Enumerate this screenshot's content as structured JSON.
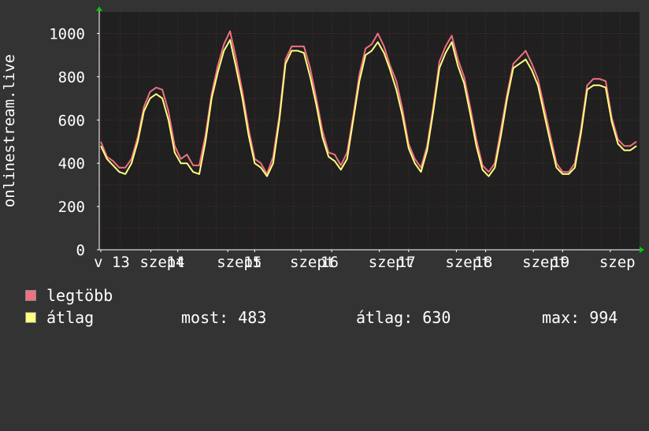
{
  "chart_data": {
    "type": "line",
    "ylabel": "onlinestream.live",
    "ylim": [
      0,
      1100
    ],
    "yticks": [
      0,
      200,
      400,
      600,
      800,
      1000
    ],
    "xlim": [
      12.98,
      20.0
    ],
    "xticks": [
      {
        "value": 13,
        "label": "v 13"
      },
      {
        "value": 13.65,
        "label": "szept"
      },
      {
        "value": 14,
        "label": "14"
      },
      {
        "value": 14.65,
        "label": "szept"
      },
      {
        "value": 15,
        "label": "15"
      },
      {
        "value": 15.6,
        "label": "szept"
      },
      {
        "value": 16,
        "label": "16"
      },
      {
        "value": 16.62,
        "label": "szept"
      },
      {
        "value": 17,
        "label": "17"
      },
      {
        "value": 17.62,
        "label": "szept"
      },
      {
        "value": 18,
        "label": "18"
      },
      {
        "value": 18.62,
        "label": "szept"
      },
      {
        "value": 19,
        "label": "19"
      },
      {
        "value": 19.62,
        "label": "szep"
      }
    ],
    "grid": true,
    "series": [
      {
        "name": "legtöbb",
        "color": "#f07080",
        "x": [
          13.0,
          13.08,
          13.16,
          13.24,
          13.32,
          13.4,
          13.48,
          13.56,
          13.64,
          13.72,
          13.8,
          13.88,
          13.96,
          14.04,
          14.12,
          14.2,
          14.28,
          14.36,
          14.44,
          14.52,
          14.6,
          14.68,
          14.76,
          14.84,
          14.92,
          15.0,
          15.08,
          15.16,
          15.24,
          15.32,
          15.4,
          15.48,
          15.56,
          15.64,
          15.72,
          15.8,
          15.88,
          15.96,
          16.04,
          16.12,
          16.2,
          16.28,
          16.36,
          16.44,
          16.52,
          16.6,
          16.68,
          16.76,
          16.84,
          16.92,
          17.0,
          17.08,
          17.16,
          17.24,
          17.32,
          17.4,
          17.48,
          17.56,
          17.64,
          17.72,
          17.8,
          17.88,
          17.96,
          18.04,
          18.12,
          18.2,
          18.28,
          18.36,
          18.44,
          18.52,
          18.6,
          18.68,
          18.76,
          18.84,
          18.92,
          19.0,
          19.08,
          19.16,
          19.24,
          19.32,
          19.4,
          19.48,
          19.56,
          19.64,
          19.72,
          19.8,
          19.88,
          19.96
        ],
        "values": [
          500,
          430,
          410,
          380,
          380,
          420,
          520,
          660,
          730,
          750,
          740,
          640,
          480,
          420,
          440,
          390,
          390,
          530,
          720,
          850,
          950,
          1010,
          880,
          730,
          560,
          420,
          400,
          350,
          430,
          620,
          880,
          940,
          940,
          940,
          840,
          700,
          550,
          450,
          440,
          390,
          450,
          620,
          810,
          930,
          950,
          1000,
          940,
          850,
          780,
          650,
          490,
          420,
          380,
          480,
          660,
          870,
          940,
          990,
          880,
          800,
          660,
          510,
          390,
          360,
          400,
          560,
          720,
          860,
          890,
          920,
          860,
          790,
          660,
          530,
          400,
          360,
          360,
          400,
          560,
          760,
          790,
          790,
          780,
          610,
          510,
          480,
          480,
          500
        ]
      },
      {
        "name": "átlag",
        "color": "#ffff80",
        "x": [
          13.0,
          13.08,
          13.16,
          13.24,
          13.32,
          13.4,
          13.48,
          13.56,
          13.64,
          13.72,
          13.8,
          13.88,
          13.96,
          14.04,
          14.12,
          14.2,
          14.28,
          14.36,
          14.44,
          14.52,
          14.6,
          14.68,
          14.76,
          14.84,
          14.92,
          15.0,
          15.08,
          15.16,
          15.24,
          15.32,
          15.4,
          15.48,
          15.56,
          15.64,
          15.72,
          15.8,
          15.88,
          15.96,
          16.04,
          16.12,
          16.2,
          16.28,
          16.36,
          16.44,
          16.52,
          16.6,
          16.68,
          16.76,
          16.84,
          16.92,
          17.0,
          17.08,
          17.16,
          17.24,
          17.32,
          17.4,
          17.48,
          17.56,
          17.64,
          17.72,
          17.8,
          17.88,
          17.96,
          18.04,
          18.12,
          18.2,
          18.28,
          18.36,
          18.44,
          18.52,
          18.6,
          18.68,
          18.76,
          18.84,
          18.92,
          19.0,
          19.08,
          19.16,
          19.24,
          19.32,
          19.4,
          19.48,
          19.56,
          19.64,
          19.72,
          19.8,
          19.88,
          19.96
        ],
        "values": [
          480,
          420,
          390,
          360,
          350,
          400,
          500,
          640,
          700,
          720,
          700,
          600,
          450,
          400,
          400,
          360,
          350,
          500,
          700,
          820,
          920,
          970,
          840,
          700,
          530,
          400,
          380,
          340,
          400,
          600,
          860,
          920,
          920,
          910,
          800,
          670,
          520,
          430,
          410,
          370,
          420,
          600,
          780,
          900,
          920,
          960,
          910,
          830,
          740,
          620,
          470,
          400,
          360,
          460,
          640,
          840,
          910,
          960,
          850,
          770,
          630,
          480,
          370,
          340,
          380,
          530,
          700,
          840,
          860,
          880,
          830,
          760,
          630,
          500,
          380,
          350,
          350,
          380,
          540,
          740,
          760,
          760,
          750,
          590,
          490,
          460,
          460,
          480
        ]
      }
    ]
  },
  "legend": {
    "items": [
      {
        "label": "legtöbb",
        "color": "#f07080"
      },
      {
        "label": "átlag",
        "color": "#ffff80"
      }
    ],
    "stats": {
      "most": "most: 483",
      "atlag": "átlag: 630",
      "max": "max: 994"
    }
  },
  "colors": {
    "background": "#333333",
    "plot_background": "#202020",
    "grid": "#5a2a2a",
    "axis": "#ffffff",
    "arrow": "#00cc00"
  }
}
